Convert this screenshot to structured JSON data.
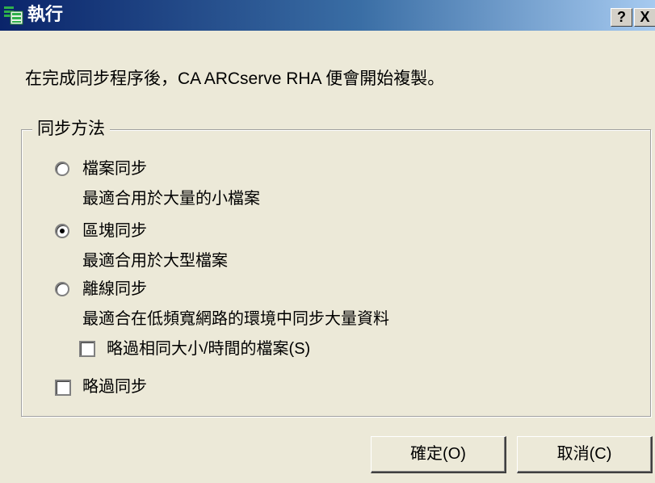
{
  "window": {
    "title": "執行",
    "help_label": "?",
    "close_label": "X"
  },
  "message": "在完成同步程序後，CA ARCserve RHA 便會開始複製。",
  "sync_group": {
    "legend": "同步方法",
    "options": [
      {
        "label": "檔案同步",
        "description": "最適合用於大量的小檔案",
        "selected": false
      },
      {
        "label": "區塊同步",
        "description": "最適合用於大型檔案",
        "selected": true
      },
      {
        "label": "離線同步",
        "description": "最適合在低頻寬網路的環境中同步大量資料",
        "selected": false
      }
    ],
    "ignore_same_files": {
      "label": "略過相同大小/時間的檔案(S)",
      "checked": false
    },
    "skip_sync": {
      "label": "略過同步",
      "checked": false
    }
  },
  "buttons": {
    "ok": "確定(O)",
    "cancel": "取消(C)"
  },
  "colors": {
    "titlebar_start": "#0a246a",
    "titlebar_end": "#a6caf0",
    "dialog_bg": "#ece9d8"
  }
}
